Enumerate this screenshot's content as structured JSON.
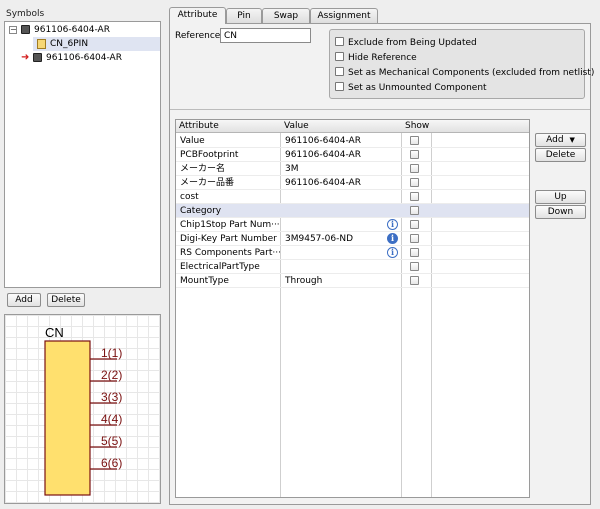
{
  "left": {
    "symbols_label": "Symbols",
    "tree": [
      {
        "label": "961106-6404-AR",
        "type": "chip",
        "expander": "⊟"
      },
      {
        "label": "CN_6PIN",
        "type": "symbol"
      },
      {
        "label": "961106-6404-AR",
        "type": "chip-arrow"
      }
    ],
    "add_label": "Add",
    "delete_label": "Delete",
    "preview": {
      "ref": "CN",
      "pins": [
        "1(1)",
        "2(2)",
        "3(3)",
        "4(4)",
        "5(5)",
        "6(6)"
      ]
    }
  },
  "tabs": [
    "Attribute",
    "Pin",
    "Swap",
    "Assignment"
  ],
  "reference": {
    "label": "Reference",
    "value": "CN"
  },
  "options": [
    "Exclude from Being Updated",
    "Hide Reference",
    "Set as Mechanical Components (excluded from netlist)",
    "Set as Unmounted Component"
  ],
  "grid": {
    "headers": [
      "Attribute",
      "Value",
      "Show"
    ],
    "rows": [
      {
        "attr": "Value",
        "value": "961106-6404-AR",
        "info": ""
      },
      {
        "attr": "PCBFootprint",
        "value": "961106-6404-AR",
        "info": ""
      },
      {
        "attr": "メーカー名",
        "value": "3M",
        "info": ""
      },
      {
        "attr": "メーカー品番",
        "value": "961106-6404-AR",
        "info": ""
      },
      {
        "attr": "cost",
        "value": "",
        "info": ""
      },
      {
        "attr": "Category",
        "value": "",
        "info": ""
      },
      {
        "attr": "Chip1Stop Part Num···",
        "value": "",
        "info": "outline"
      },
      {
        "attr": "Digi-Key Part Number",
        "value": "3M9457-06-ND",
        "info": "filled"
      },
      {
        "attr": "RS Components Part···",
        "value": "",
        "info": "outline"
      },
      {
        "attr": "ElectricalPartType",
        "value": "",
        "info": ""
      },
      {
        "attr": "MountType",
        "value": "Through",
        "info": ""
      }
    ],
    "selected_row": 5
  },
  "side_buttons": {
    "add": "Add",
    "delete": "Delete",
    "up": "Up",
    "down": "Down"
  },
  "colors": {
    "selection": "#dfe3f1",
    "symbol_fill": "#ffe06e",
    "pin_text": "#7a1010",
    "info_blue": "#3d6fc4"
  },
  "icons": {
    "add_dropdown": "▼",
    "info": "i",
    "tree_arrow": "➜"
  }
}
